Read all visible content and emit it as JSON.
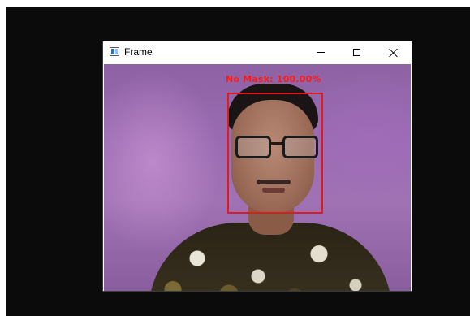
{
  "window": {
    "title": "Frame",
    "controls": {
      "minimize_icon": "minimize-icon",
      "maximize_icon": "maximize-icon",
      "close_icon": "close-icon"
    }
  },
  "detection": {
    "label": "No Mask: 100.00%",
    "box_color": "#e01b1b"
  },
  "colors": {
    "backdrop": "#0b0b0b",
    "detection": "#ff1a1a"
  }
}
